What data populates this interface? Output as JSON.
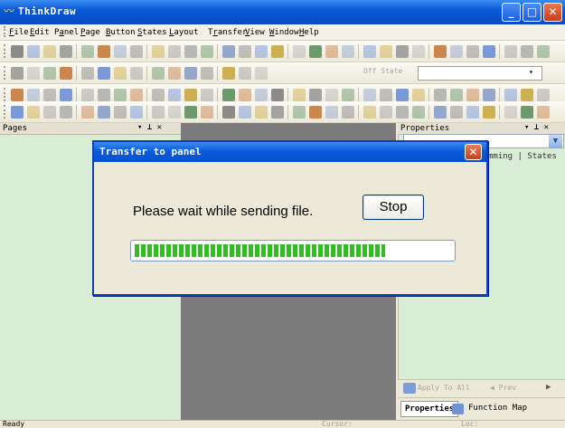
{
  "window": {
    "title": "ThinkDraw",
    "minimize": "_",
    "maximize": "□",
    "close": "✕"
  },
  "menu": [
    {
      "pre": "",
      "key": "F",
      "post": "ile"
    },
    {
      "pre": "",
      "key": "E",
      "post": "dit"
    },
    {
      "pre": "P",
      "key": "a",
      "post": "nel"
    },
    {
      "pre": "",
      "key": "P",
      "post": "age"
    },
    {
      "pre": "",
      "key": "B",
      "post": "utton"
    },
    {
      "pre": "",
      "key": "S",
      "post": "tates"
    },
    {
      "pre": "",
      "key": "L",
      "post": "ayout"
    },
    {
      "pre": "T",
      "key": "r",
      "post": "ansfer"
    },
    {
      "pre": "",
      "key": "V",
      "post": "iew"
    },
    {
      "pre": "",
      "key": "W",
      "post": "indow"
    },
    {
      "pre": "",
      "key": "H",
      "post": "elp"
    }
  ],
  "toolbar": {
    "state_label": "Off State"
  },
  "pages_panel": {
    "title": "Pages",
    "pin": "▾ ⊥ ✕"
  },
  "properties_panel": {
    "title": "Properties",
    "pin": "▾ ⊥ ✕",
    "tabs_text": "mming | States",
    "apply_label": "Apply To All",
    "prev_label": "◀ Prev",
    "next_label": "▶",
    "tab_properties": "Properties",
    "tab_function_map": "Function Map"
  },
  "status": {
    "ready": "Ready",
    "cursor": "Cursor:",
    "loc": "Loc:"
  },
  "dialog": {
    "title": "Transfer to panel",
    "close": "✕",
    "message": "Please wait while sending file.",
    "stop_label": "Stop",
    "progress": 0.79
  },
  "colors": {
    "progress_green": "#2ec01c",
    "title_blue": "#0a5ad8",
    "panel_green": "#d9ecd6"
  }
}
